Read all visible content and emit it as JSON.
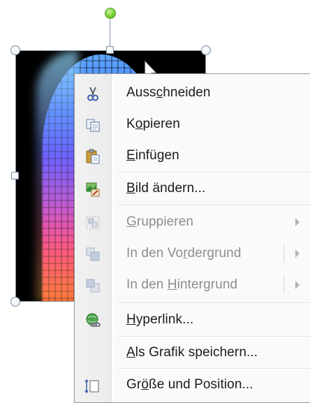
{
  "context_menu": {
    "items": [
      {
        "pre": "Auss",
        "key": "c",
        "post": "hneiden",
        "icon": "scissors-icon",
        "enabled": true,
        "submenu": false
      },
      {
        "pre": "K",
        "key": "o",
        "post": "pieren",
        "icon": "copy-icon",
        "enabled": true,
        "submenu": false
      },
      {
        "pre": "",
        "key": "E",
        "post": "infügen",
        "icon": "paste-icon",
        "enabled": true,
        "submenu": false
      },
      {
        "pre": "",
        "key": "B",
        "post": "ild ändern...",
        "icon": "change-picture-icon",
        "enabled": true,
        "submenu": false
      },
      {
        "pre": "",
        "key": "G",
        "post": "ruppieren",
        "icon": "group-icon",
        "enabled": false,
        "submenu": true
      },
      {
        "pre": "In den Vo",
        "key": "r",
        "post": "dergrund",
        "icon": "bring-to-front-icon",
        "enabled": false,
        "submenu": true
      },
      {
        "pre": "In den ",
        "key": "H",
        "post": "intergrund",
        "icon": "send-to-back-icon",
        "enabled": false,
        "submenu": true
      },
      {
        "pre": "",
        "key": "H",
        "post": "yperlink...",
        "icon": "hyperlink-icon",
        "enabled": true,
        "submenu": false
      },
      {
        "pre": "",
        "key": "A",
        "post": "ls Grafik speichern...",
        "icon": "",
        "enabled": true,
        "submenu": false
      },
      {
        "pre": "Gr",
        "key": "ö",
        "post": "ße und Position...",
        "icon": "size-position-icon",
        "enabled": true,
        "submenu": false
      }
    ]
  },
  "colors": {
    "menu_bg": "#fafafa",
    "gutter": "#eeeeee",
    "rotation_handle": "#6fcf2a",
    "disabled_text": "#8d8d8d"
  }
}
